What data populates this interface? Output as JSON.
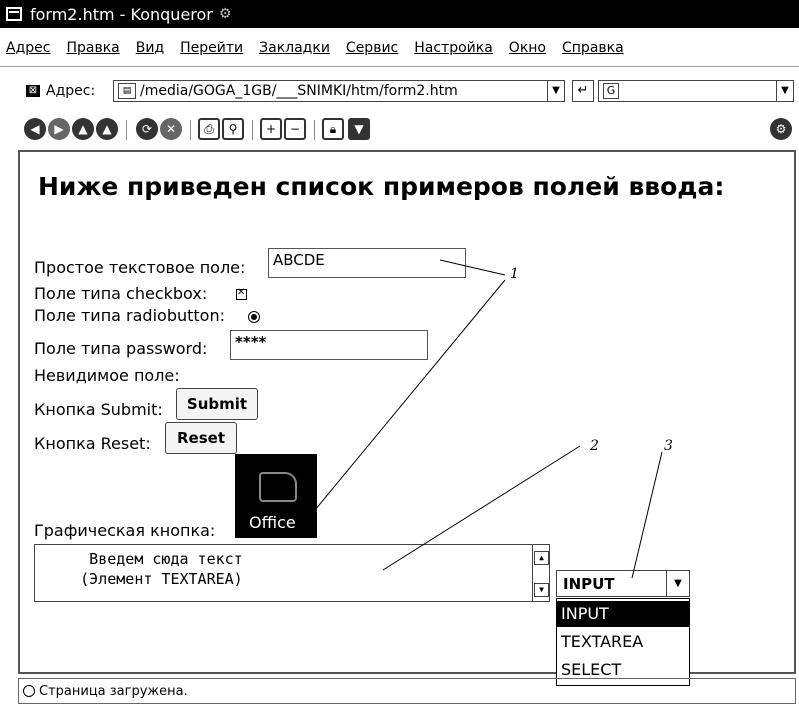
{
  "window": {
    "title": "form2.htm - Konqueror"
  },
  "menu": [
    "Адрес",
    "Правка",
    "Вид",
    "Перейти",
    "Закладки",
    "Сервис",
    "Настройка",
    "Окно",
    "Справка"
  ],
  "location": {
    "label": "Адрес:",
    "url": "/media/GOGA_1GB/___SNIMKI/htm/form2.htm",
    "search_prefix": "G"
  },
  "toolbar": {
    "icons": [
      "back-icon",
      "forward-icon",
      "up-icon",
      "reload-icon",
      "home-icon",
      "stop-icon",
      "print-icon",
      "find-icon",
      "zoom-in-icon",
      "zoom-out-icon",
      "lock-icon",
      "download-icon",
      "settings-icon"
    ]
  },
  "page": {
    "heading": "Ниже приведен список примеров полей ввода:",
    "text_field_label": "Простое текстовое поле:",
    "text_field_value": "ABCDE",
    "checkbox_label": "Поле типа checkbox:",
    "radio_label": "Поле типа radiobutton:",
    "password_label": "Поле типа password:",
    "password_value": "****",
    "hidden_label": "Невидимое поле:",
    "submit_label": "Кнопка Submit:",
    "submit_button": "Submit",
    "reset_label": "Кнопка Reset:",
    "reset_button": "Reset",
    "image_button_label": "Графическая кнопка:",
    "image_button_text": "Office",
    "textarea_line1": "      Введем сюда текст",
    "textarea_line2": "     (Элемент TEXTAREA)",
    "select_value": "INPUT",
    "select_options": [
      "INPUT",
      "TEXTAREA",
      "SELECT"
    ]
  },
  "annotations": [
    "1",
    "2",
    "3"
  ],
  "status": {
    "text": "Страница загружена."
  }
}
